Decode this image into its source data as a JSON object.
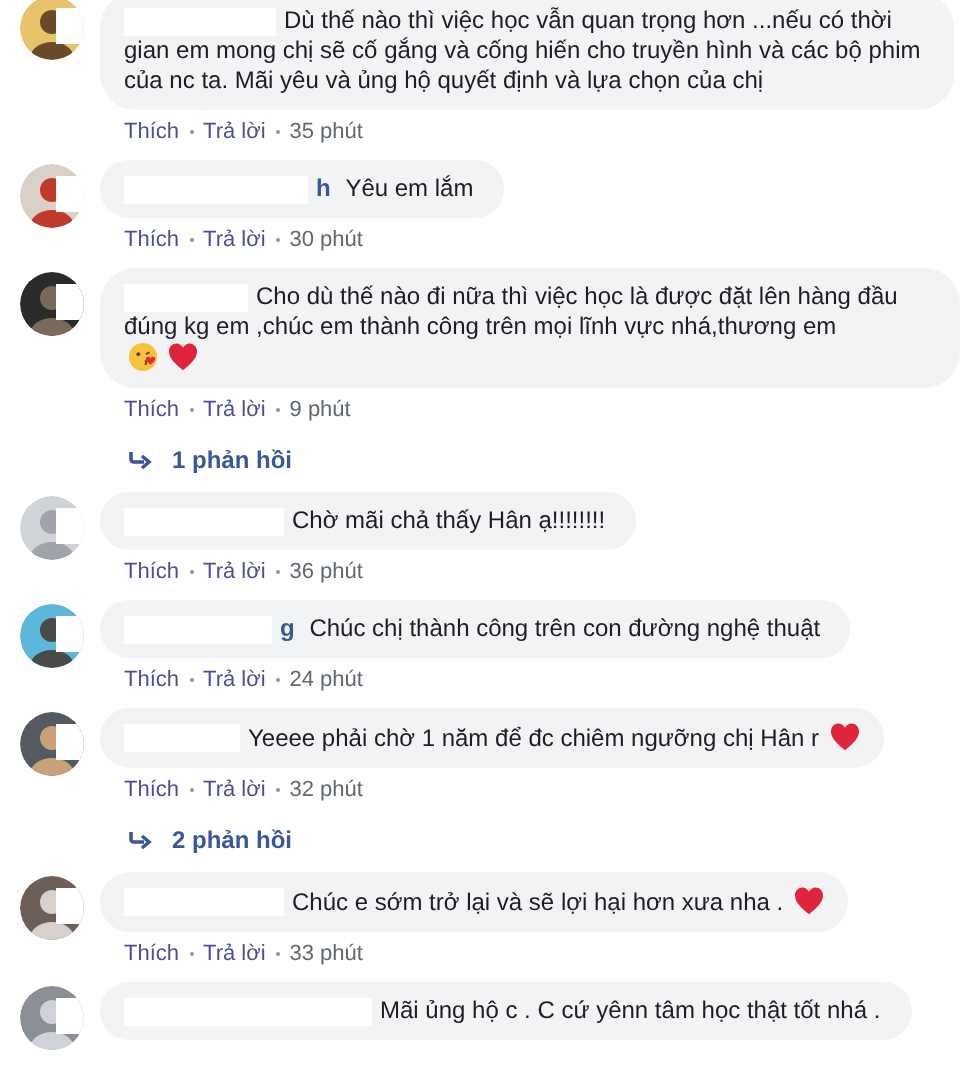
{
  "comments": [
    {
      "text": "Dù thế nào thì việc học vẫn quan trọng hơn ...nếu có thời gian em mong chị sẽ cố gắng và cống hiến cho truyền hình và các bộ phim của nc ta. Mãi yêu và ủng hộ quyết định và lựa chọn của chị",
      "actions": [
        "Thích",
        "Trả lời"
      ],
      "time": "35 phút"
    },
    {
      "name_fragment": "h",
      "text": "Yêu em lắm",
      "actions": [
        "Thích",
        "Trả lời"
      ],
      "time": "30 phút"
    },
    {
      "text": "Cho dù thế nào đi nữa thì việc học là được đặt lên hàng đầu đúng kg em ,chúc em thành công trên mọi lĩnh vực nhá,thương em",
      "emojis": [
        {
          "kind": "kiss_face"
        },
        {
          "kind": "heart"
        }
      ],
      "actions": [
        "Thích",
        "Trả lời"
      ],
      "time": "9 phút",
      "replies": "1 phản hồi"
    },
    {
      "text": "Chờ mãi chả thấy Hân ạ!!!!!!!!",
      "actions": [
        "Thích",
        "Trả lời"
      ],
      "time": "36 phút"
    },
    {
      "name_fragment": "g",
      "text": "Chúc chị thành công trên con đường nghệ thuật",
      "actions": [
        "Thích",
        "Trả lời"
      ],
      "time": "24 phút"
    },
    {
      "text": "Yeeee phải chờ 1 năm để đc chiêm ngưỡng chị Hân r",
      "emojis": [
        {
          "kind": "heart"
        }
      ],
      "actions": [
        "Thích",
        "Trả lời"
      ],
      "time": "32 phút",
      "replies": "2 phản hồi"
    },
    {
      "text": "Chúc e sớm trở lại và sẽ lợi hại hơn xưa nha .",
      "emojis": [
        {
          "kind": "heart"
        }
      ],
      "actions": [
        "Thích",
        "Trả lời"
      ],
      "time": "33 phút"
    },
    {
      "text": "Mãi ủng hộ c . C cứ yênn tâm học thật tốt nhá ."
    }
  ]
}
